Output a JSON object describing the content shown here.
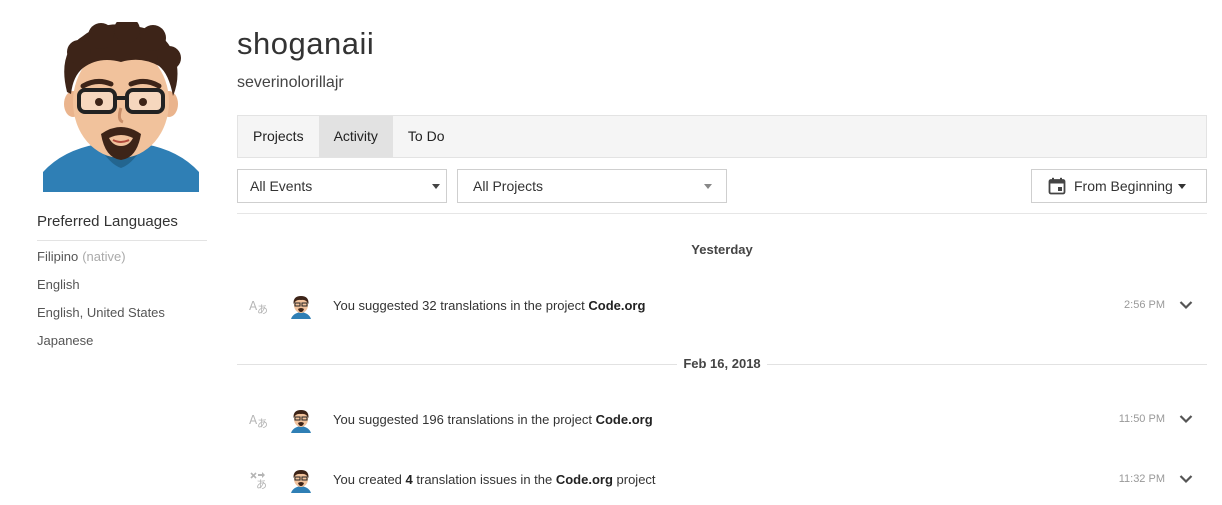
{
  "profile": {
    "display_name": "shoganaii",
    "username": "severinolorillajr"
  },
  "sidebar": {
    "preferred_languages_title": "Preferred Languages",
    "languages": [
      {
        "name": "Filipino",
        "note": "(native)"
      },
      {
        "name": "English",
        "note": ""
      },
      {
        "name": "English, United States",
        "note": ""
      },
      {
        "name": "Japanese",
        "note": ""
      }
    ]
  },
  "tabs": [
    {
      "label": "Projects",
      "active": false
    },
    {
      "label": "Activity",
      "active": true
    },
    {
      "label": "To Do",
      "active": false
    }
  ],
  "filters": {
    "events_value": "All Events",
    "projects_value": "All Projects",
    "date_label": "From Beginning"
  },
  "timeline": [
    {
      "day": "Yesterday",
      "events": [
        {
          "icon": "translate-icon",
          "prefix": "You suggested 32 translations in the project ",
          "target": "Code.org",
          "suffix": "",
          "time": "2:56 PM"
        }
      ]
    },
    {
      "day": "Feb 16, 2018",
      "events": [
        {
          "icon": "translate-icon",
          "prefix": "You suggested 196 translations in the project ",
          "target": "Code.org",
          "suffix": "",
          "time": "11:50 PM"
        },
        {
          "icon": "translation-issue-icon",
          "prefix": "You created ",
          "count": "4",
          "middle": " translation issues in the ",
          "target": "Code.org",
          "suffix": " project",
          "time": "11:32 PM"
        }
      ]
    }
  ],
  "colors": {
    "accent_text": "#333333",
    "muted_text": "#999999",
    "tab_active_bg": "#e2e2e2",
    "tabbar_bg": "#f5f5f5"
  }
}
